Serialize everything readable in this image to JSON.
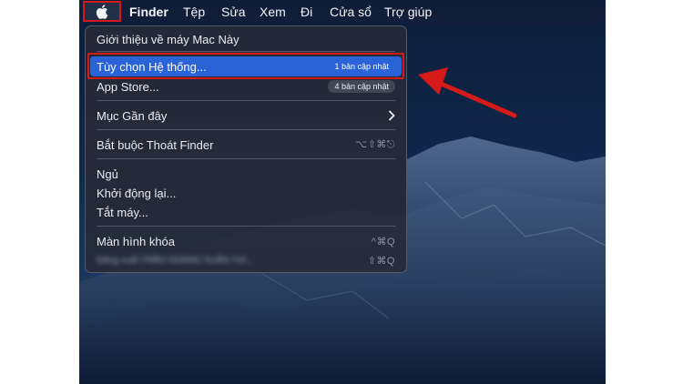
{
  "menubar": {
    "apple_icon": "apple-logo",
    "app_name": "Finder",
    "items": [
      "Tệp",
      "Sửa",
      "Xem",
      "Đi",
      "Cửa sổ",
      "Trợ giúp"
    ]
  },
  "apple_menu": {
    "about": "Giới thiệu về máy Mac Này",
    "system_prefs": {
      "label": "Tùy chọn Hệ thống...",
      "badge": "1 bản cập nhật"
    },
    "app_store": {
      "label": "App Store...",
      "badge": "4 bản cập nhật"
    },
    "recent_items": {
      "label": "Mục Gần đây",
      "icon": "chevron-right"
    },
    "force_quit": {
      "label": "Bắt buộc Thoát Finder",
      "shortcut": "⌥⇧⌘⎋"
    },
    "sleep": "Ngủ",
    "restart": "Khởi động lại...",
    "shutdown": "Tắt máy...",
    "lock_screen": {
      "label": "Màn hình khóa",
      "shortcut": "^⌘Q"
    },
    "logout": {
      "label": "Đăng xuất TRẦN HOÀNG XUÂN THI...",
      "shortcut": "⇧⌘Q"
    }
  },
  "colors": {
    "highlight": "#2a62d8",
    "annotation_red": "#d51a1a",
    "menu_bg": "#262a36"
  }
}
